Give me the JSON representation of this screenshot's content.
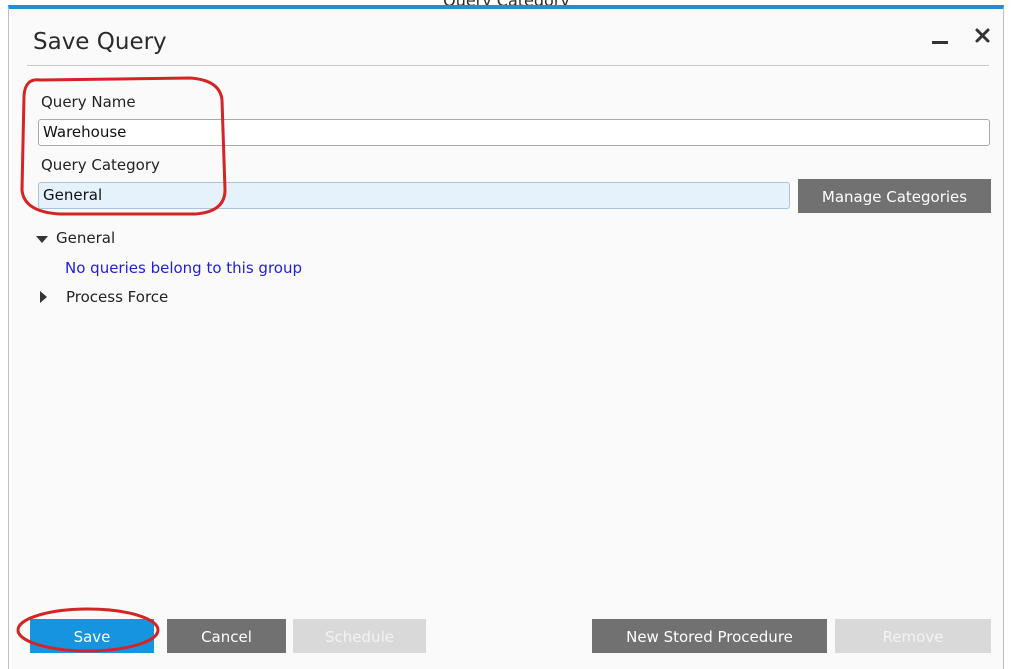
{
  "top_caption": "Query Category",
  "window": {
    "title": "Save Query"
  },
  "form": {
    "query_name_label": "Query Name",
    "query_name_value": "Warehouse",
    "query_category_label": "Query Category",
    "query_category_value": "General",
    "manage_categories_label": "Manage Categories"
  },
  "tree": {
    "groups": [
      {
        "label": "General",
        "expanded": true,
        "empty_message": "No queries belong to this group"
      },
      {
        "label": "Process Force",
        "expanded": false
      }
    ]
  },
  "buttons": {
    "save": "Save",
    "cancel": "Cancel",
    "schedule": "Schedule",
    "new_stored_procedure": "New Stored Procedure",
    "remove": "Remove"
  },
  "colors": {
    "accent": "#1e90d8",
    "annotation": "#d42424",
    "empty_message": "#1f1fd6"
  },
  "icons": {
    "minimize": "minimize-icon",
    "close": "close-icon",
    "expanded": "triangle-down-icon",
    "collapsed": "triangle-right-icon"
  }
}
